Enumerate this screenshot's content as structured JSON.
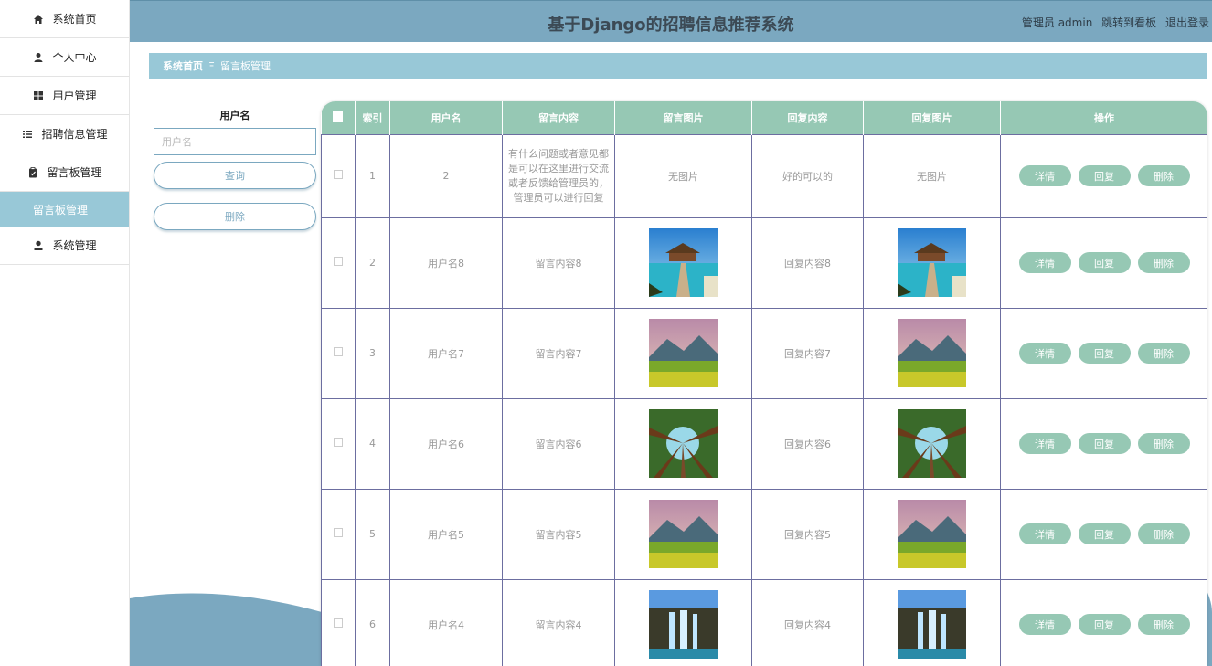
{
  "app": {
    "title": "基于Django的招聘信息推荐系统",
    "user_label": "管理员 admin",
    "dashboard_link": "跳转到看板",
    "logout_link": "退出登录"
  },
  "sidebar": {
    "items": [
      {
        "label": "系统首页",
        "icon": "home-icon"
      },
      {
        "label": "个人中心",
        "icon": "user-icon"
      },
      {
        "label": "用户管理",
        "icon": "grid-icon"
      },
      {
        "label": "招聘信息管理",
        "icon": "list-icon"
      },
      {
        "label": "留言板管理",
        "icon": "clipboard-icon"
      },
      {
        "label": "留言板管理",
        "active": true
      },
      {
        "label": "系统管理",
        "icon": "admin-user-icon"
      }
    ]
  },
  "breadcrumb": {
    "home": "系统首页",
    "separator": "Ξ",
    "current": "留言板管理"
  },
  "search": {
    "label": "用户名",
    "placeholder": "用户名",
    "query_label": "查询",
    "delete_label": "删除"
  },
  "table": {
    "headers": [
      "",
      "索引",
      "用户名",
      "留言内容",
      "留言图片",
      "回复内容",
      "回复图片",
      "操作"
    ],
    "rows": [
      {
        "index": "1",
        "username": "2",
        "content": "有什么问题或者意见都是可以在这里进行交流或者反馈给管理员的，管理员可以进行回复",
        "image": "无图片",
        "reply": "好的可以的",
        "reply_image": "无图片"
      },
      {
        "index": "2",
        "username": "用户名8",
        "content": "留言内容8",
        "image": "beach",
        "reply": "回复内容8",
        "reply_image": "beach"
      },
      {
        "index": "3",
        "username": "用户名7",
        "content": "留言内容7",
        "image": "meadow",
        "reply": "回复内容7",
        "reply_image": "meadow"
      },
      {
        "index": "4",
        "username": "用户名6",
        "content": "留言内容6",
        "image": "forest",
        "reply": "回复内容6",
        "reply_image": "forest"
      },
      {
        "index": "5",
        "username": "用户名5",
        "content": "留言内容5",
        "image": "meadow",
        "reply": "回复内容5",
        "reply_image": "meadow"
      },
      {
        "index": "6",
        "username": "用户名4",
        "content": "留言内容4",
        "image": "waterfall",
        "reply": "回复内容4",
        "reply_image": "waterfall"
      }
    ],
    "actions": {
      "detail": "详情",
      "reply": "回复",
      "delete": "删除"
    }
  },
  "colors": {
    "header": "#7ba8c0",
    "accent": "#98c8d7",
    "table_header": "#96c8b4"
  }
}
